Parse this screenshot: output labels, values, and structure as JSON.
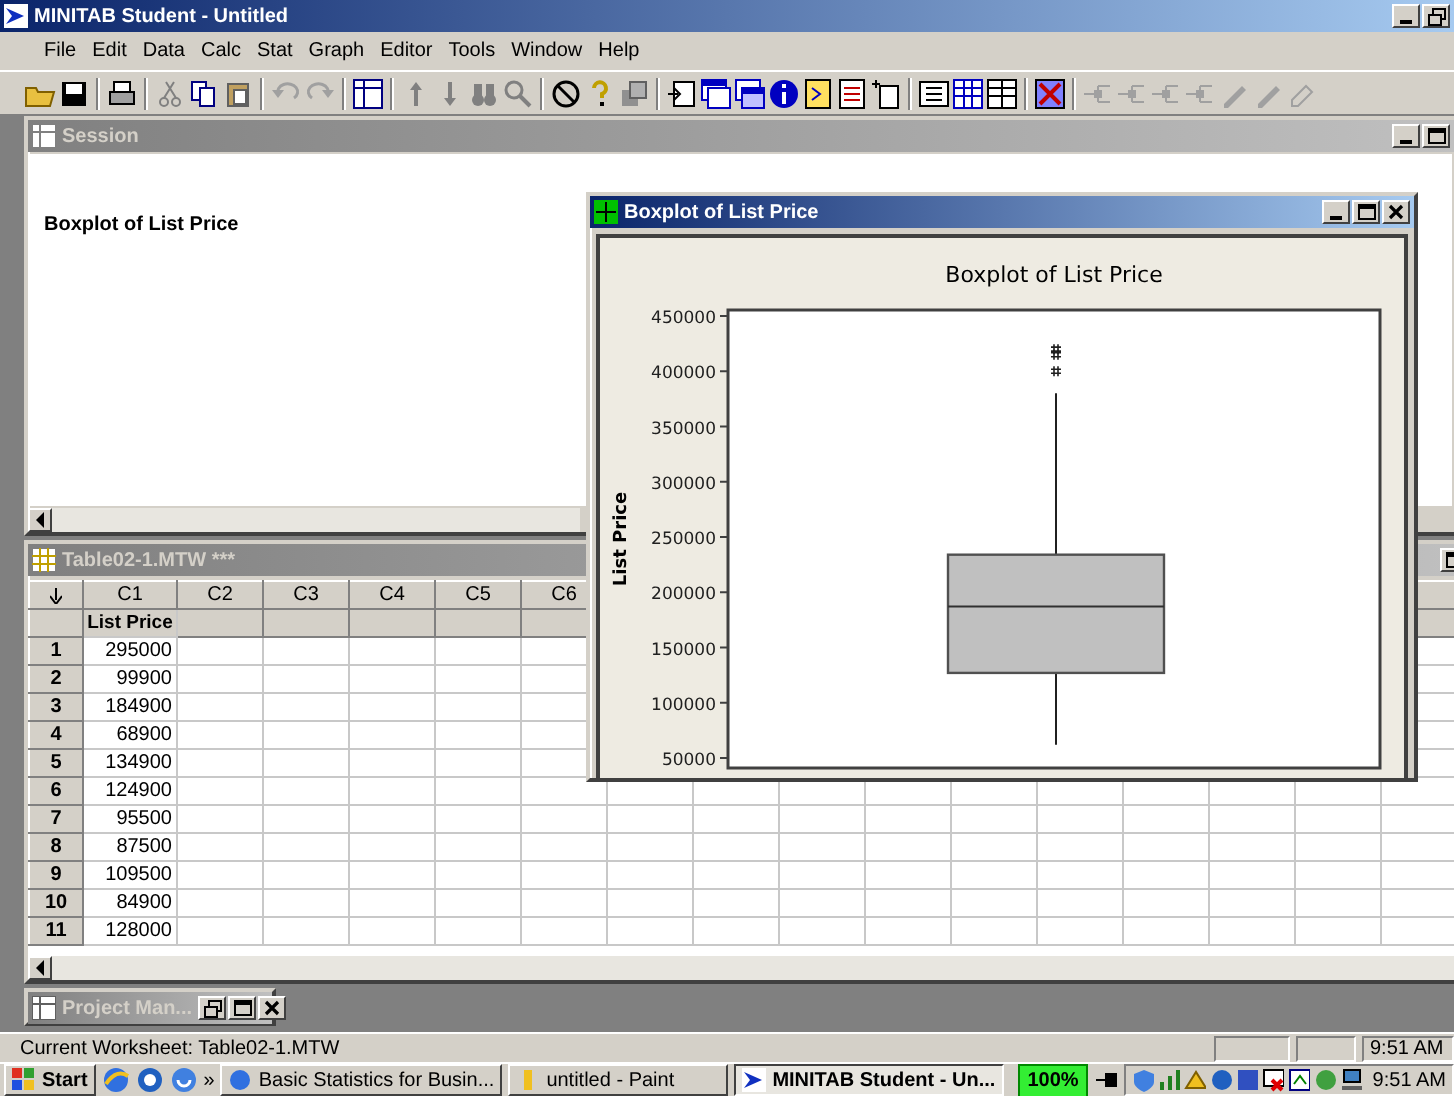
{
  "app": {
    "title": "MINITAB Student - Untitled",
    "menu": [
      "File",
      "Edit",
      "Data",
      "Calc",
      "Stat",
      "Graph",
      "Editor",
      "Tools",
      "Window",
      "Help"
    ]
  },
  "session": {
    "title": "Session",
    "heading": "Boxplot of List Price"
  },
  "worksheet": {
    "title": "Table02-1.MTW ***",
    "columns": [
      {
        "id": "C1",
        "name": "List Price"
      },
      {
        "id": "C2"
      },
      {
        "id": "C3"
      },
      {
        "id": "C4"
      },
      {
        "id": "C5"
      },
      {
        "id": "C6"
      }
    ],
    "rows": [
      {
        "number": "1",
        "values": [
          "295000"
        ]
      },
      {
        "number": "2",
        "values": [
          "99900"
        ]
      },
      {
        "number": "3",
        "values": [
          "184900"
        ]
      },
      {
        "number": "4",
        "values": [
          "68900"
        ]
      },
      {
        "number": "5",
        "values": [
          "134900"
        ]
      },
      {
        "number": "6",
        "values": [
          "124900"
        ]
      },
      {
        "number": "7",
        "values": [
          "95500"
        ]
      },
      {
        "number": "8",
        "values": [
          "87500"
        ]
      },
      {
        "number": "9",
        "values": [
          "109500"
        ]
      },
      {
        "number": "10",
        "values": [
          "84900"
        ]
      },
      {
        "number": "11",
        "values": [
          "128000"
        ]
      }
    ]
  },
  "graph_window": {
    "title": "Boxplot of List Price",
    "chart": {
      "title": "Boxplot of List Price",
      "ylabel": "List Price",
      "yticks": [
        "450000",
        "400000",
        "350000",
        "300000",
        "250000",
        "200000",
        "150000",
        "100000",
        "50000"
      ]
    }
  },
  "project_manager": {
    "title": "Project Man..."
  },
  "status_bar": {
    "worksheet": "Current Worksheet: Table02-1.MTW",
    "time": "9:51 AM"
  },
  "taskbar": {
    "start": "Start",
    "overflow": "»",
    "tasks": [
      {
        "label": "Basic Statistics for Busin...",
        "selected": false
      },
      {
        "label": "untitled - Paint",
        "selected": false
      },
      {
        "label": "MINITAB Student - Un...",
        "selected": true
      }
    ],
    "zoom": "100%",
    "clock": "9:51 AM"
  }
}
